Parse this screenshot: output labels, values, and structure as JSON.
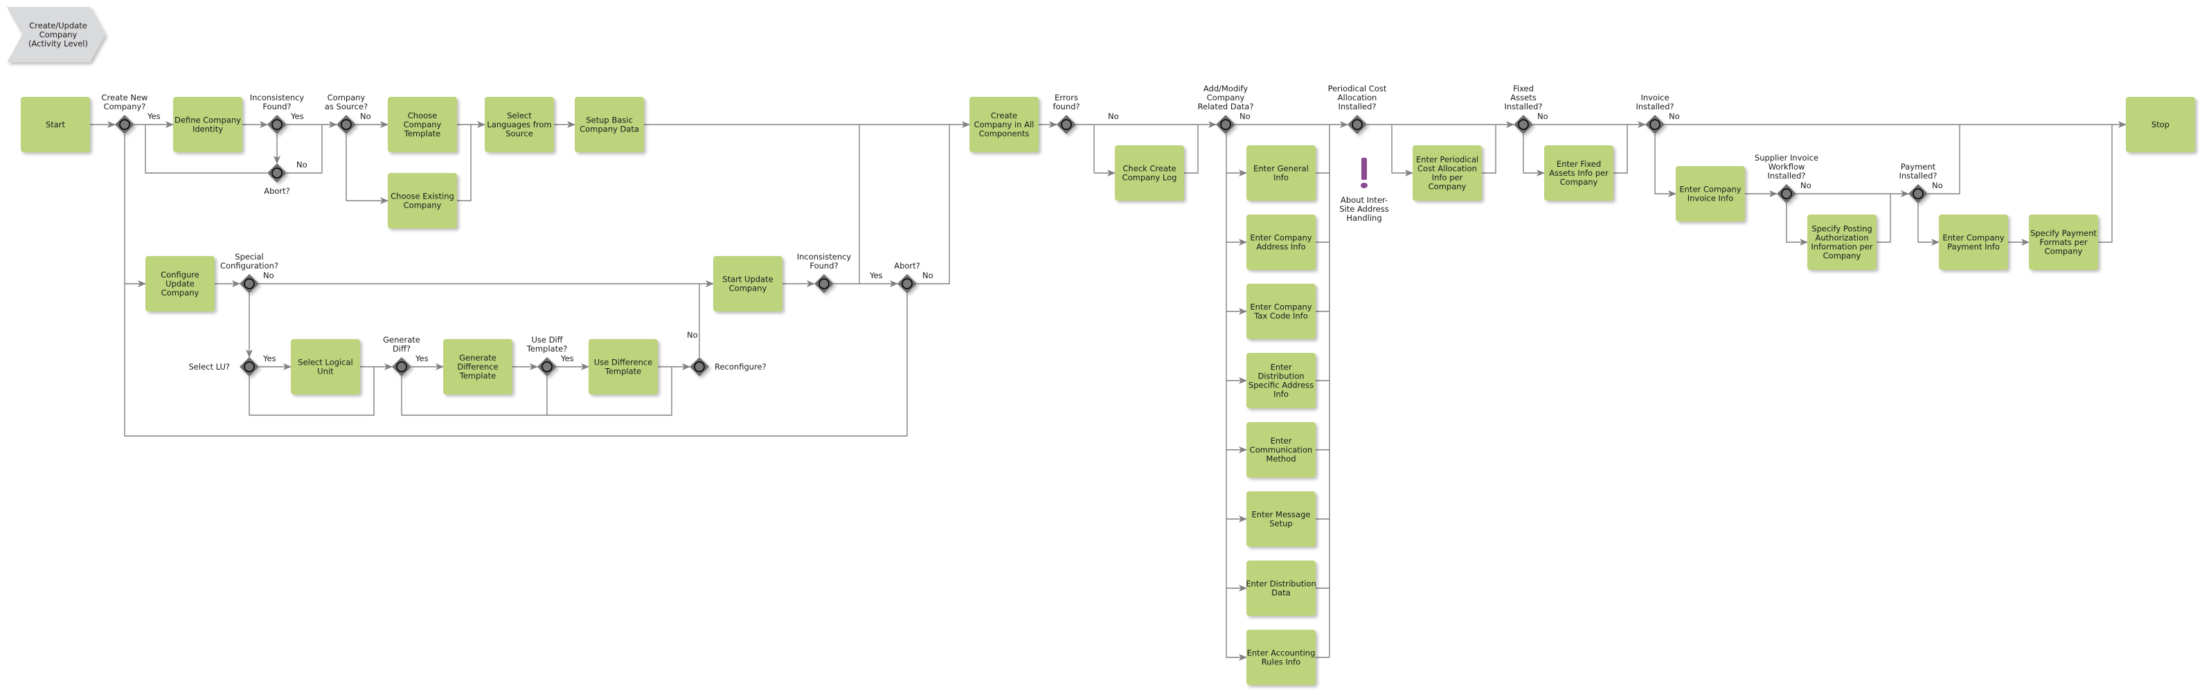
{
  "diagram": {
    "title": "Create/Update Company (Activity Level)",
    "title_lines": [
      "Create/Update",
      "Company",
      "(Activity Level)"
    ],
    "colors": {
      "task_fill": "#bdd37b",
      "gateway_fill": "#6e6e6e",
      "connector": "#808080",
      "title_fill": "#d9dadc",
      "note_icon": "#8b4a93"
    },
    "tasks": [
      {
        "id": "start",
        "lines": [
          "Start"
        ]
      },
      {
        "id": "define_identity",
        "lines": [
          "Define Company",
          "Identity"
        ]
      },
      {
        "id": "choose_template",
        "lines": [
          "Choose",
          "Company",
          "Template"
        ]
      },
      {
        "id": "choose_existing",
        "lines": [
          "Choose Existing",
          "Company"
        ]
      },
      {
        "id": "select_languages",
        "lines": [
          "Select",
          "Languages from",
          "Source"
        ]
      },
      {
        "id": "setup_basic",
        "lines": [
          "Setup Basic",
          "Company Data"
        ]
      },
      {
        "id": "configure_update",
        "lines": [
          "Configure",
          "Update",
          "Company"
        ]
      },
      {
        "id": "select_lu",
        "lines": [
          "Select Logical",
          "Unit"
        ]
      },
      {
        "id": "generate_diff",
        "lines": [
          "Generate",
          "Difference",
          "Template"
        ]
      },
      {
        "id": "use_diff",
        "lines": [
          "Use Difference",
          "Template"
        ]
      },
      {
        "id": "start_update",
        "lines": [
          "Start Update",
          "Company"
        ]
      },
      {
        "id": "create_all",
        "lines": [
          "Create",
          "Company in All",
          "Components"
        ]
      },
      {
        "id": "check_log",
        "lines": [
          "Check Create",
          "Company Log"
        ]
      },
      {
        "id": "general_info",
        "lines": [
          "Enter General",
          "Info"
        ]
      },
      {
        "id": "address_info",
        "lines": [
          "Enter Company",
          "Address Info"
        ]
      },
      {
        "id": "tax_code",
        "lines": [
          "Enter Company",
          "Tax Code Info"
        ]
      },
      {
        "id": "dist_address",
        "lines": [
          "Enter",
          "Distribution",
          "Specific Address",
          "Info"
        ]
      },
      {
        "id": "comm_method",
        "lines": [
          "Enter",
          "Communication",
          "Method"
        ]
      },
      {
        "id": "message_setup",
        "lines": [
          "Enter Message",
          "Setup"
        ]
      },
      {
        "id": "dist_data",
        "lines": [
          "Enter Distribution",
          "Data"
        ]
      },
      {
        "id": "accounting_rules",
        "lines": [
          "Enter Accounting",
          "Rules Info"
        ]
      },
      {
        "id": "periodical",
        "lines": [
          "Enter Periodical",
          "Cost Allocation",
          "Info per",
          "Company"
        ]
      },
      {
        "id": "fixed_assets",
        "lines": [
          "Enter Fixed",
          "Assets Info per",
          "Company"
        ]
      },
      {
        "id": "invoice_info",
        "lines": [
          "Enter Company",
          "Invoice Info"
        ]
      },
      {
        "id": "posting_auth",
        "lines": [
          "Specify Posting",
          "Authorization",
          "Information per",
          "Company"
        ]
      },
      {
        "id": "payment_info",
        "lines": [
          "Enter Company",
          "Payment Info"
        ]
      },
      {
        "id": "payment_formats",
        "lines": [
          "Specify Payment",
          "Formats per",
          "Company"
        ]
      },
      {
        "id": "stop",
        "lines": [
          "Stop"
        ]
      }
    ],
    "gateways": [
      {
        "id": "g_create_new",
        "lines": [
          "Create New",
          "Company?"
        ]
      },
      {
        "id": "g_inconsistency1",
        "lines": [
          "Inconsistency",
          "Found?"
        ]
      },
      {
        "id": "g_abort1",
        "lines": [
          "Abort?"
        ]
      },
      {
        "id": "g_company_source",
        "lines": [
          "Company",
          "as Source?"
        ]
      },
      {
        "id": "g_special_config",
        "lines": [
          "Special",
          "Configuration?"
        ]
      },
      {
        "id": "g_select_lu",
        "lines": [
          "Select LU?"
        ]
      },
      {
        "id": "g_generate_diff",
        "lines": [
          "Generate",
          "Diff?"
        ]
      },
      {
        "id": "g_use_diff",
        "lines": [
          "Use Diff",
          "Template?"
        ]
      },
      {
        "id": "g_reconfigure",
        "lines": [
          "Reconfigure?"
        ]
      },
      {
        "id": "g_inconsistency2",
        "lines": [
          "Inconsistency",
          "Found?"
        ]
      },
      {
        "id": "g_abort2",
        "lines": [
          "Abort?"
        ]
      },
      {
        "id": "g_errors",
        "lines": [
          "Errors",
          "found?"
        ]
      },
      {
        "id": "g_add_modify",
        "lines": [
          "Add/Modify",
          "Company",
          "Related Data?"
        ]
      },
      {
        "id": "g_periodical",
        "lines": [
          "Periodical Cost",
          "Allocation",
          "Installed?"
        ]
      },
      {
        "id": "g_fixed_assets",
        "lines": [
          "Fixed",
          "Assets",
          "Installed?"
        ]
      },
      {
        "id": "g_invoice",
        "lines": [
          "Invoice",
          "Installed?"
        ]
      },
      {
        "id": "g_supplier_wf",
        "lines": [
          "Supplier Invoice",
          "Workflow",
          "Installed?"
        ]
      },
      {
        "id": "g_payment",
        "lines": [
          "Payment",
          "Installed?"
        ]
      }
    ],
    "note": {
      "id": "inter_site_note",
      "icon": "exclamation-icon",
      "lines": [
        "About Inter-",
        "Site Address",
        "Handling"
      ]
    },
    "edge_labels": [
      {
        "id": "l_create_yes",
        "text": "Yes"
      },
      {
        "id": "l_incons1_yes",
        "text": "Yes"
      },
      {
        "id": "l_abort1_no",
        "text": "No"
      },
      {
        "id": "l_source_no",
        "text": "No"
      },
      {
        "id": "l_special_no",
        "text": "No"
      },
      {
        "id": "l_lu_yes",
        "text": "Yes"
      },
      {
        "id": "l_gendiff_yes",
        "text": "Yes"
      },
      {
        "id": "l_usediff_yes",
        "text": "Yes"
      },
      {
        "id": "l_reconf_no",
        "text": "No"
      },
      {
        "id": "l_abort2_yes",
        "text": "Yes"
      },
      {
        "id": "l_abort2_no",
        "text": "No"
      },
      {
        "id": "l_errors_no",
        "text": "No"
      },
      {
        "id": "l_addmod_no",
        "text": "No"
      },
      {
        "id": "l_fixed_no",
        "text": "No"
      },
      {
        "id": "l_invoice_no",
        "text": "No"
      },
      {
        "id": "l_supplier_no",
        "text": "No"
      },
      {
        "id": "l_payment_no",
        "text": "No"
      }
    ]
  }
}
